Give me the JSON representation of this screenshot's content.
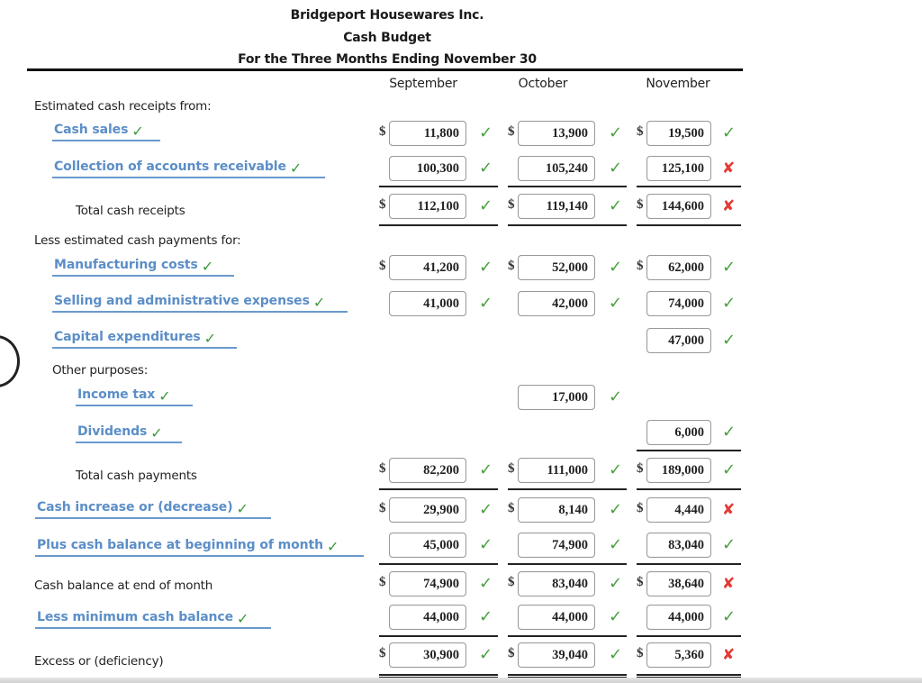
{
  "header": {
    "company": "Bridgeport Housewares Inc.",
    "statement": "Cash Budget",
    "period": "For the Three Months Ending November 30"
  },
  "columns": [
    "September",
    "October",
    "November"
  ],
  "currency_symbol": "$",
  "labels": {
    "receipts_heading": "Estimated cash receipts from:",
    "cash_sales": "Cash sales",
    "collection_ar": "Collection of accounts receivable",
    "total_receipts": "Total cash receipts",
    "payments_heading": "Less estimated cash payments for:",
    "manufacturing_costs": "Manufacturing costs",
    "selling_admin": "Selling and administrative expenses",
    "capital_expenditures": "Capital expenditures",
    "other_purposes": "Other purposes:",
    "income_tax": "Income tax",
    "dividends": "Dividends",
    "total_payments": "Total cash payments",
    "cash_increase": "Cash increase or (decrease)",
    "plus_beginning": "Plus cash balance at beginning of month",
    "end_balance": "Cash balance at end of month",
    "less_minimum": "Less minimum cash balance",
    "excess": "Excess or (deficiency)"
  },
  "label_status": {
    "cash_sales": "correct",
    "collection_ar": "correct",
    "manufacturing_costs": "correct",
    "selling_admin": "correct",
    "capital_expenditures": "correct",
    "income_tax": "correct",
    "dividends": "correct",
    "cash_increase": "correct",
    "plus_beginning": "correct",
    "less_minimum": "correct"
  },
  "rows": {
    "cash_sales": [
      {
        "value": "11,800",
        "status": "correct"
      },
      {
        "value": "13,900",
        "status": "correct"
      },
      {
        "value": "19,500",
        "status": "correct"
      }
    ],
    "collection_ar": [
      {
        "value": "100,300",
        "status": "correct"
      },
      {
        "value": "105,240",
        "status": "correct"
      },
      {
        "value": "125,100",
        "status": "incorrect"
      }
    ],
    "total_receipts": [
      {
        "value": "112,100",
        "status": "correct"
      },
      {
        "value": "119,140",
        "status": "correct"
      },
      {
        "value": "144,600",
        "status": "incorrect"
      }
    ],
    "manufacturing_costs": [
      {
        "value": "41,200",
        "status": "correct"
      },
      {
        "value": "52,000",
        "status": "correct"
      },
      {
        "value": "62,000",
        "status": "correct"
      }
    ],
    "selling_admin": [
      {
        "value": "41,000",
        "status": "correct"
      },
      {
        "value": "42,000",
        "status": "correct"
      },
      {
        "value": "74,000",
        "status": "correct"
      }
    ],
    "capital_expenditures": [
      null,
      null,
      {
        "value": "47,000",
        "status": "correct"
      }
    ],
    "income_tax": [
      null,
      {
        "value": "17,000",
        "status": "correct"
      },
      null
    ],
    "dividends": [
      null,
      null,
      {
        "value": "6,000",
        "status": "correct"
      }
    ],
    "total_payments": [
      {
        "value": "82,200",
        "status": "correct"
      },
      {
        "value": "111,000",
        "status": "correct"
      },
      {
        "value": "189,000",
        "status": "correct"
      }
    ],
    "cash_increase": [
      {
        "value": "29,900",
        "status": "correct"
      },
      {
        "value": "8,140",
        "status": "correct"
      },
      {
        "value": "4,440",
        "status": "incorrect"
      }
    ],
    "plus_beginning": [
      {
        "value": "45,000",
        "status": "correct"
      },
      {
        "value": "74,900",
        "status": "correct"
      },
      {
        "value": "83,040",
        "status": "correct"
      }
    ],
    "end_balance": [
      {
        "value": "74,900",
        "status": "correct"
      },
      {
        "value": "83,040",
        "status": "correct"
      },
      {
        "value": "38,640",
        "status": "incorrect"
      }
    ],
    "less_minimum": [
      {
        "value": "44,000",
        "status": "correct"
      },
      {
        "value": "44,000",
        "status": "correct"
      },
      {
        "value": "44,000",
        "status": "correct"
      }
    ],
    "excess": [
      {
        "value": "30,900",
        "status": "correct"
      },
      {
        "value": "39,040",
        "status": "correct"
      },
      {
        "value": "5,360",
        "status": "incorrect"
      }
    ]
  },
  "icons": {
    "correct": "✔",
    "incorrect": "✘"
  },
  "colors": {
    "correct": "#4aa03f",
    "incorrect": "#e53935",
    "label_link": "#5b8ec7"
  }
}
